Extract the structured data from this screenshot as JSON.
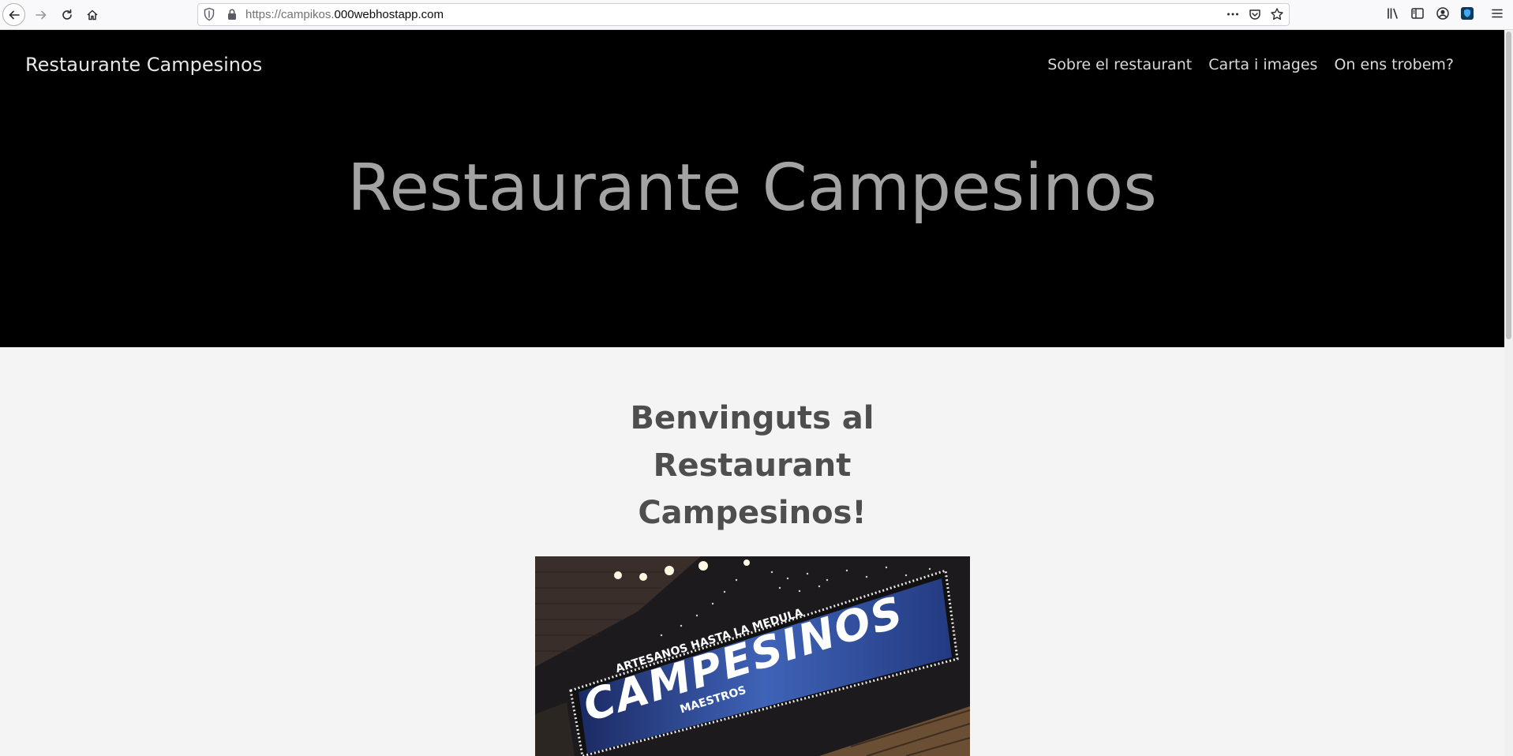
{
  "browser": {
    "url_prefix": "https://campikos.",
    "url_domain": "000webhostapp.com",
    "icons": {
      "back": "back-arrow-icon",
      "forward": "forward-arrow-icon",
      "reload": "reload-icon",
      "home": "home-icon",
      "tracking": "shield-icon",
      "secure": "lock-icon",
      "page_actions": "ellipsis-icon",
      "pocket": "pocket-icon",
      "bookmark": "star-icon",
      "library": "library-icon",
      "sidebar": "sidebar-icon",
      "account": "account-icon",
      "extension": "extension-shield-icon",
      "menu": "hamburger-menu-icon"
    }
  },
  "site": {
    "brand": "Restaurante Campesinos",
    "nav": [
      {
        "label": "Sobre el restaurant"
      },
      {
        "label": "Carta i images"
      },
      {
        "label": "On ens trobem?"
      }
    ],
    "hero_title": "Restaurante Campesinos",
    "welcome_heading": "Benvinguts al Restaurant Campesinos!",
    "photo": {
      "sign_tagline": "ARTESANOS HASTA LA MEDULA",
      "sign_name": "CAMPESINOS",
      "sign_sub": "MAESTROS"
    }
  },
  "colors": {
    "hero_bg": "#000000",
    "page_bg": "#f4f4f4",
    "hero_title": "#a3a3a3",
    "heading": "#4e4e4e"
  }
}
